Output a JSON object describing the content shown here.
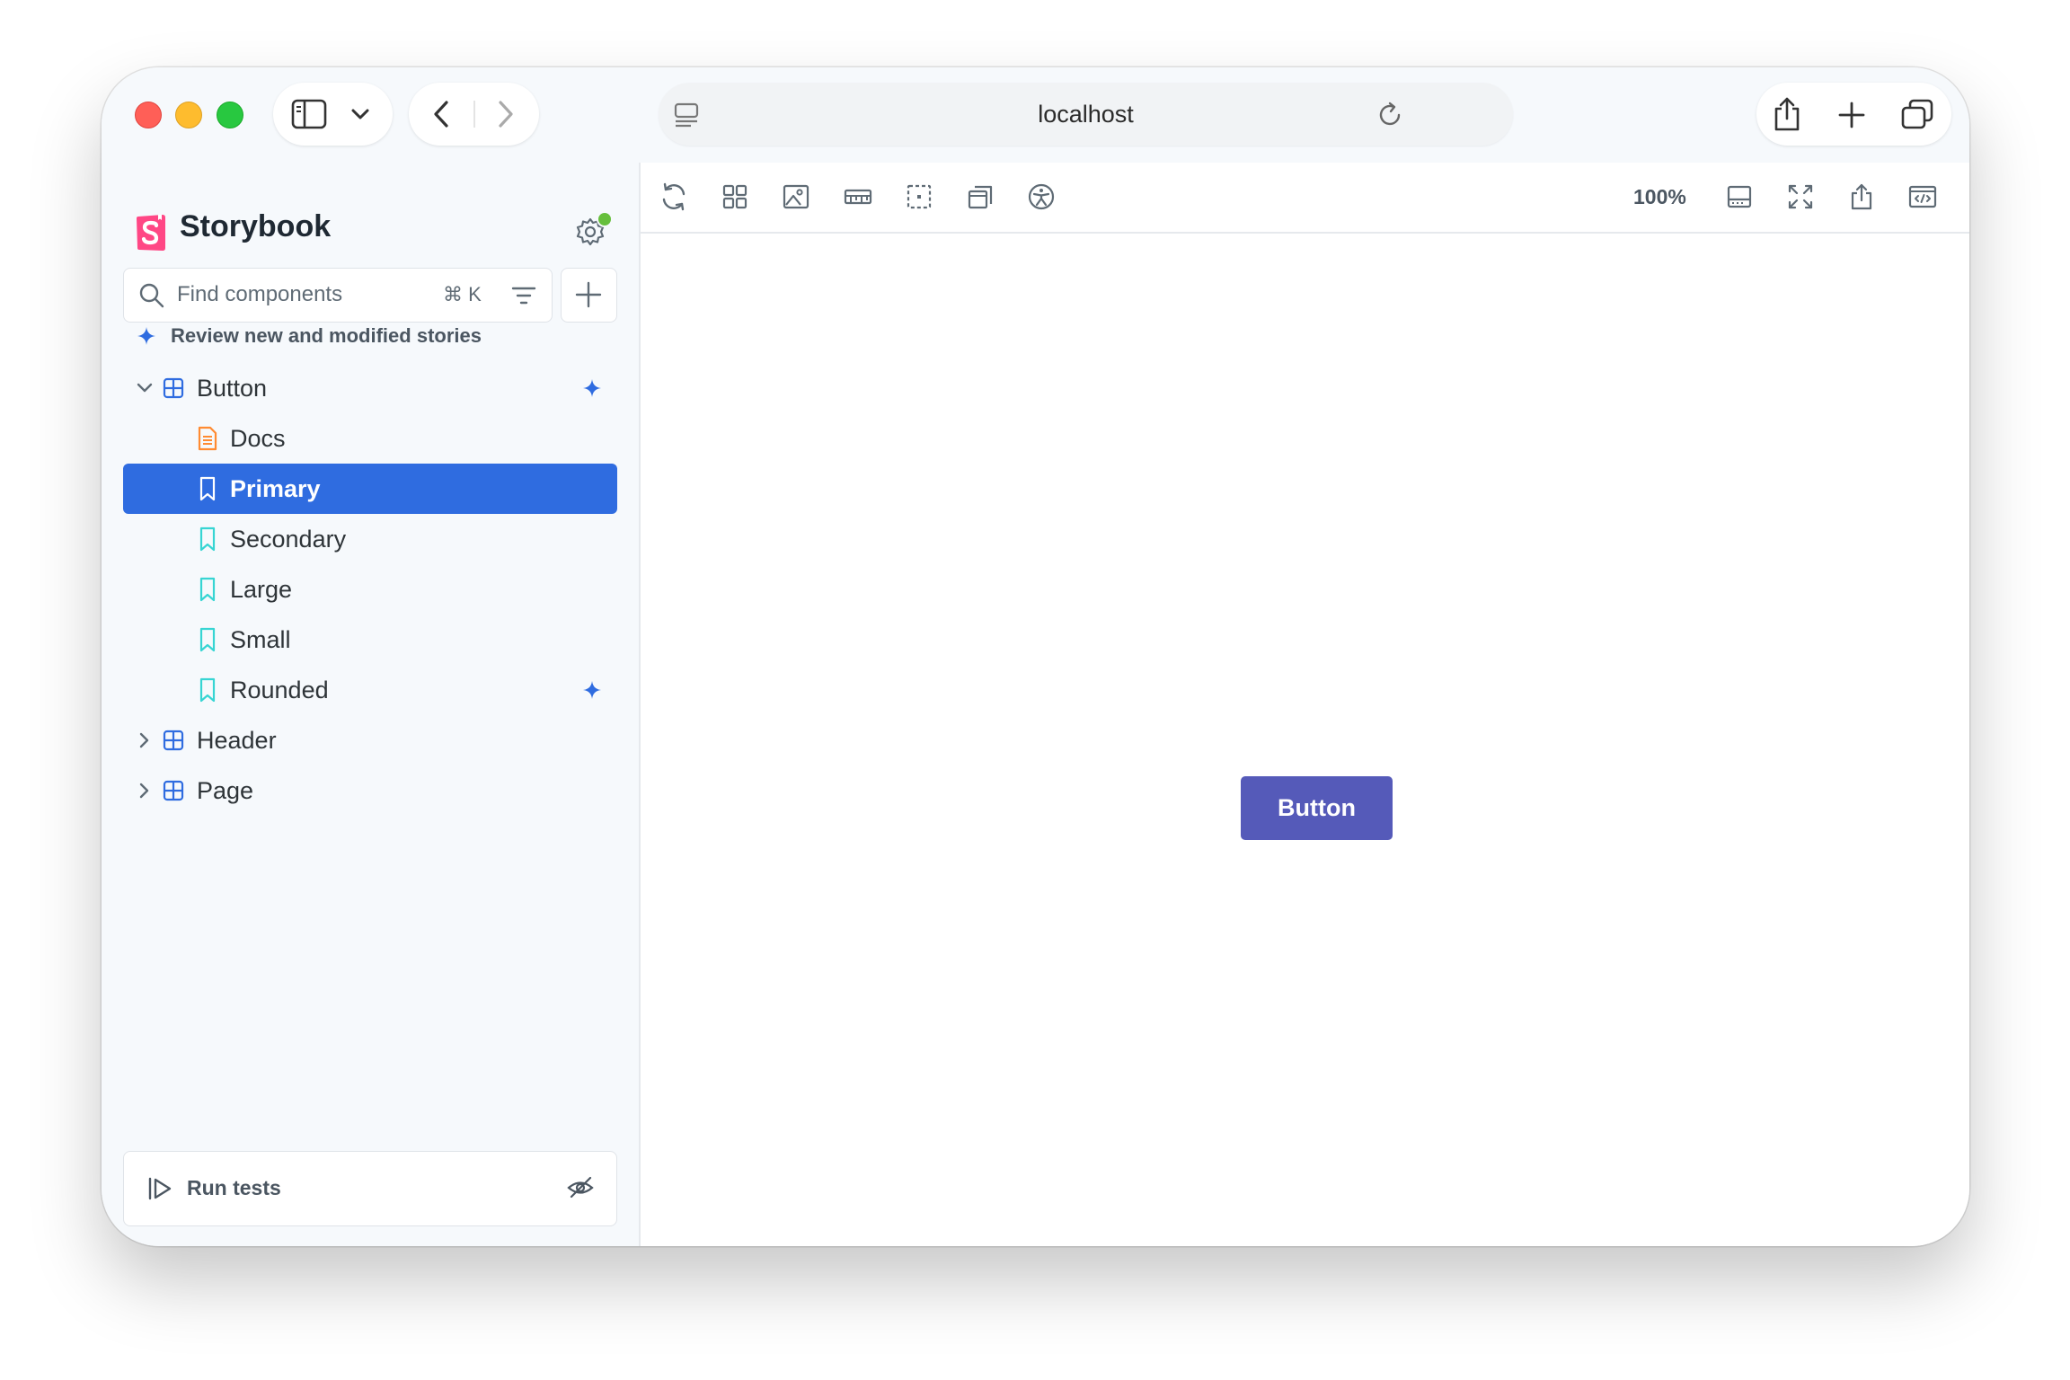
{
  "browser": {
    "address": "localhost"
  },
  "sidebar": {
    "brand": "Storybook",
    "search": {
      "placeholder": "Find components",
      "shortcut": "⌘ K"
    },
    "review_link": "Review new and modified stories",
    "tree": [
      {
        "label": "Button",
        "kind": "component",
        "expanded": true,
        "changed": true
      },
      {
        "label": "Docs",
        "kind": "docs"
      },
      {
        "label": "Primary",
        "kind": "story",
        "selected": true
      },
      {
        "label": "Secondary",
        "kind": "story"
      },
      {
        "label": "Large",
        "kind": "story"
      },
      {
        "label": "Small",
        "kind": "story"
      },
      {
        "label": "Rounded",
        "kind": "story",
        "changed": true
      },
      {
        "label": "Header",
        "kind": "component",
        "expanded": false
      },
      {
        "label": "Page",
        "kind": "component",
        "expanded": false
      }
    ],
    "run_tests_label": "Run tests"
  },
  "toolbar": {
    "zoom": "100%"
  },
  "preview": {
    "button_label": "Button"
  },
  "colors": {
    "accent": "#2f6ce0",
    "brand": "#ff4785",
    "story_icon": "#37d5d3",
    "docs_icon": "#ff8b32",
    "demo_button": "#555ab9",
    "status_dot": "#66bf3c"
  }
}
